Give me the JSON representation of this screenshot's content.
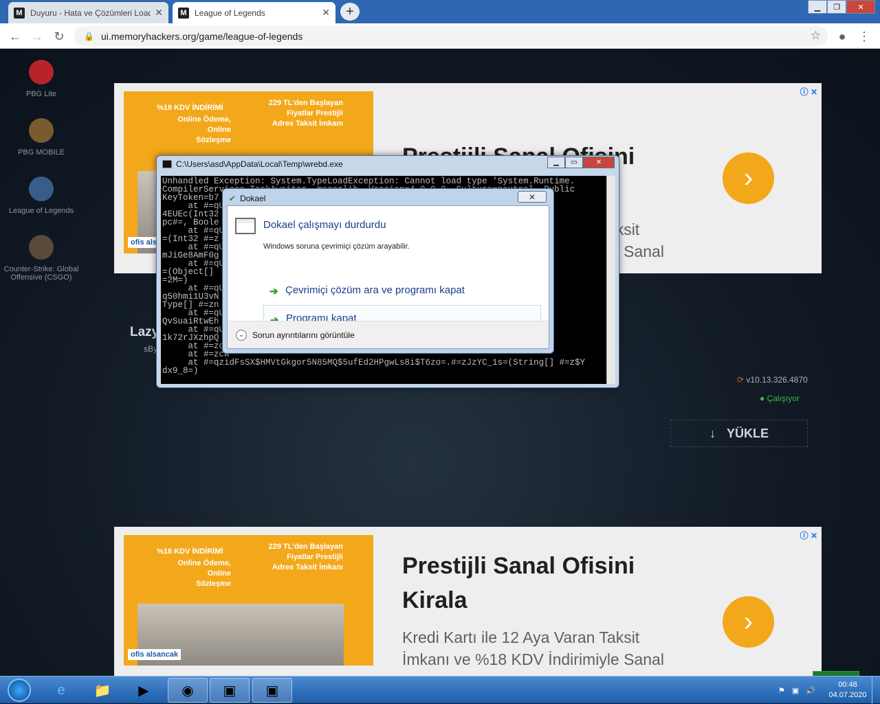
{
  "browser": {
    "tabs": [
      {
        "title": "Duyuru - Hata ve Çözümleri Load",
        "favicon": "M"
      },
      {
        "title": "League of Legends",
        "favicon": "M"
      }
    ],
    "url": "ui.memoryhackers.org/game/league-of-legends"
  },
  "sidebar": {
    "games": [
      "PBG Lite",
      "PBG MOBILE",
      "League of Legends",
      "Counter-Strike: Global Offensive (CSGO)"
    ]
  },
  "ad": {
    "discount": "%18 KDV İNDİRİMİ",
    "payment": "Online Ödeme, Online Sözleşme",
    "price": "229 TL'den Başlayan Fiyatlar Prestijli Adres Taksit İmkanı",
    "brand": "ofis alsancak",
    "headline1": "Prestijli Sanal Ofisini",
    "headline2": "Kirala",
    "sub1": "Kredi Kartı ile 12 Aya Varan Taksit",
    "sub2": "İmkanı ve %18 KDV İndirimiyle Sanal"
  },
  "release": {
    "title_fragment": "Lazy",
    "author_fragment": "sBy",
    "version": "v10.13.326.4870",
    "status": "Çalışıyor",
    "download": "YÜKLE"
  },
  "console": {
    "title": "C:\\Users\\asd\\AppData\\Local\\Temp\\wrebd.exe",
    "text": "Unhandled Exception: System.TypeLoadException: Cannot load type 'System.Runtime.\nCompilerServices.TaskAwaiter, mscorlib, Version=4.0.0.0, Culture=neutral, Public\nKeyToken=b7                                                       <JUypPCg0\n     at #=qUp                                                      ] #=zfP5f\n4EUEc(Int32                                                       lc$JmUuJA\npc#=, Boole\n     at #=qUp                                                      RpYDIoiyX\n=(Int32 #=z\n     at #=qUp                                                      PYgX9ZJJA\nmJiGe8AmF0g                                                       ] #=zn4af\n     at #=qUp\n=(Object[]                                                        C7Um$LOym\n=2M=)                                                              rJexiM=,\n     at #=qUp\nq50hmi1U3vN                                                        oVv6rP_0\nType[] #=zn                                                        rJexiM=)\n     at #=qUp                                                      g9xITgHAb\nQvSuaiRtwEh                                                        iM=)\n     at #=qUp\n1k72rJXzhpQ\n     at #=zcw\n     at #=zcw\n     at #=qzidFsSX$HMVtGkgor5N85MQ$5ufEd2HPgwLs8i$T6zo=.#=zJzYC_1s=(String[] #=z$Y\ndx9_8=)"
  },
  "dialog": {
    "title": "Dokael",
    "heading": "Dokael çalışmayı durdurdu",
    "message": "Windows soruna çevrimiçi çözüm arayabilir.",
    "option1": "Çevrimiçi çözüm ara ve programı kapat",
    "option2": "Programı kapat",
    "details": "Sorun ayrıntılarını görüntüle"
  },
  "taskbar": {
    "time": "00:48",
    "date": "04.07.2020"
  }
}
